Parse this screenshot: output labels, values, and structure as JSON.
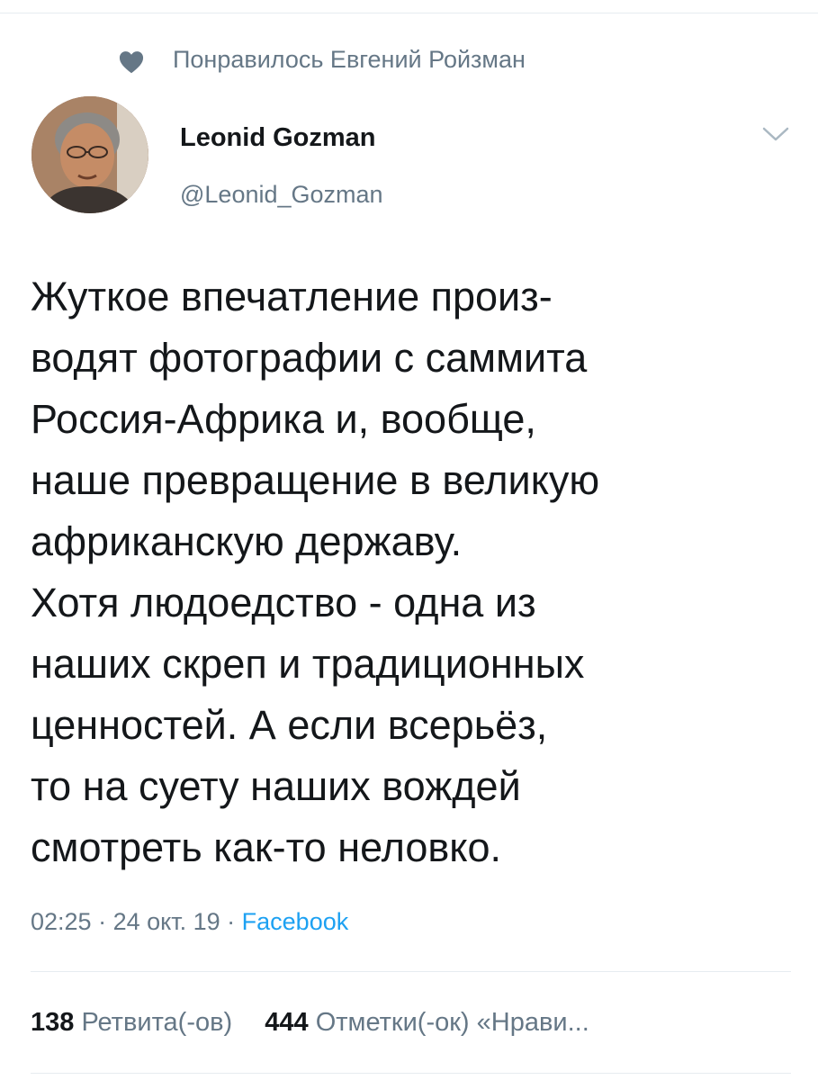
{
  "social_context": {
    "icon": "heart-icon",
    "text": "Понравилось Евгений Ройзман"
  },
  "author": {
    "display_name": "Leonid Gozman",
    "handle": "@Leonid_Gozman",
    "avatar": "avatar-photo"
  },
  "menu": {
    "icon": "chevron-down-icon"
  },
  "tweet": {
    "lines": [
      "Жуткое впечатление произ-",
      "водят фотографии с саммита",
      "Россия-Африка и, вообще,",
      "наше превращение в великую",
      "африканскую державу.",
      "Хотя людоедство - одна из",
      "наших скреп и традиционных",
      "ценностей. А если всерьёз,",
      "то на суету наших вождей",
      "смотреть как-то неловко."
    ]
  },
  "meta": {
    "time": "02:25",
    "separator": " · ",
    "date": "24 окт. 19",
    "source": "Facebook"
  },
  "stats": {
    "retweets_count": "138",
    "retweets_label": "Ретвита(-ов)",
    "likes_count": "444",
    "likes_label": "Отметки(-ок) «Нрави..."
  },
  "colors": {
    "text_primary": "#14171a",
    "text_secondary": "#657786",
    "link": "#1da1f2",
    "divider": "#e6ecf0"
  }
}
